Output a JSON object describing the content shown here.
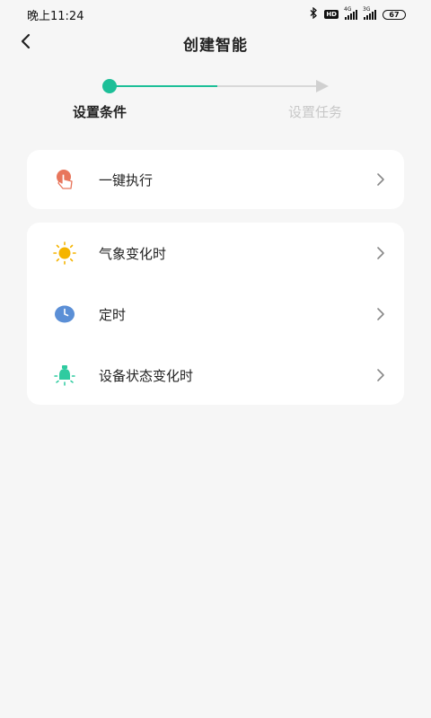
{
  "status_bar": {
    "time": "晚上11:24",
    "network_tag": "HD",
    "signal_1": "4G",
    "signal_2": "3G",
    "battery": "67"
  },
  "header": {
    "title": "创建智能"
  },
  "stepper": {
    "step1": "设置条件",
    "step2": "设置任务",
    "active_color": "#1dbf98",
    "inactive_color": "#c8c8c8"
  },
  "conditions": {
    "manual": {
      "label": "一键执行",
      "icon": "tap-hand-icon"
    },
    "items": [
      {
        "label": "气象变化时",
        "icon": "sun-icon"
      },
      {
        "label": "定时",
        "icon": "clock-icon"
      },
      {
        "label": "设备状态变化时",
        "icon": "device-light-icon"
      }
    ]
  }
}
